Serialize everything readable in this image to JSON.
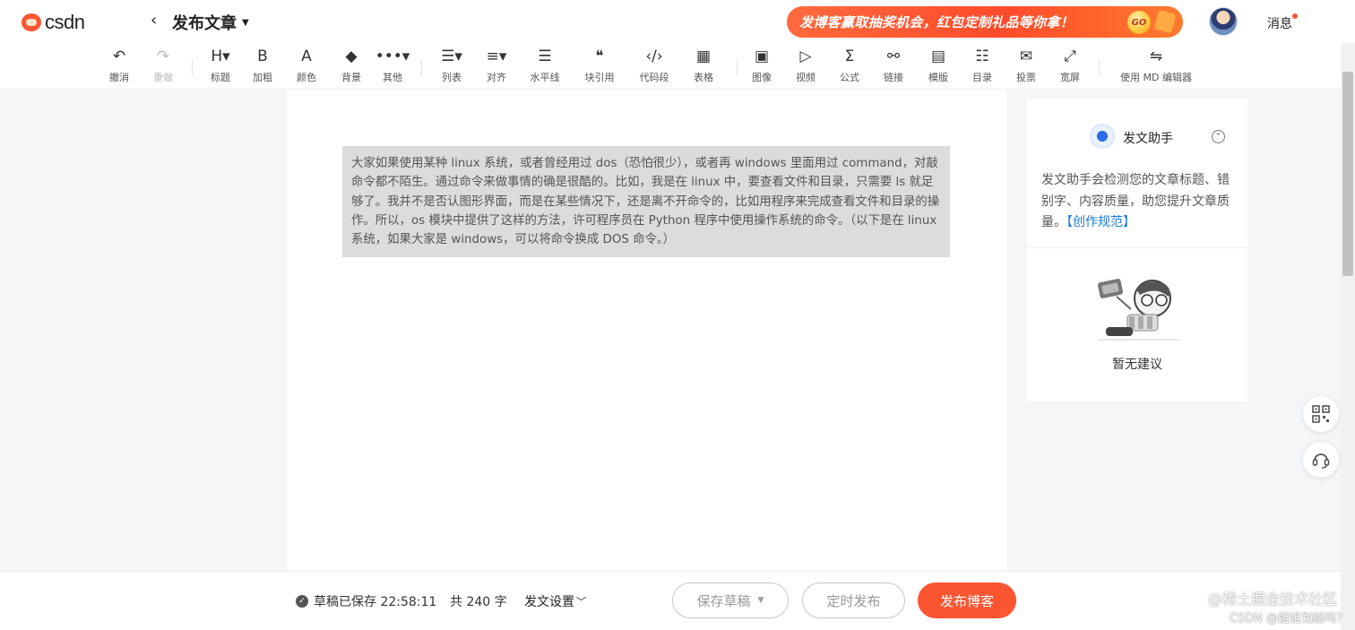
{
  "header": {
    "logo_text": "CSDN",
    "page_title": "发布文章",
    "banner_text": "发博客赢取抽奖机会，红包定制礼品等你拿！",
    "banner_go": "GO",
    "messages_label": "消息"
  },
  "toolbar": {
    "items": [
      {
        "icon": "↶",
        "label": "撤消",
        "disabled": false
      },
      {
        "icon": "↷",
        "label": "重做",
        "disabled": true
      },
      {
        "icon": "H▾",
        "label": "标题",
        "disabled": false
      },
      {
        "icon": "B",
        "label": "加粗",
        "disabled": false
      },
      {
        "icon": "A",
        "label": "颜色",
        "disabled": false
      },
      {
        "icon": "◆",
        "label": "背景",
        "disabled": false
      },
      {
        "icon": "•••▾",
        "label": "其他",
        "disabled": false
      },
      {
        "icon": "☰▾",
        "label": "列表",
        "disabled": false
      },
      {
        "icon": "≡▾",
        "label": "对齐",
        "disabled": false
      },
      {
        "icon": "☰",
        "label": "水平线",
        "disabled": false
      },
      {
        "icon": "❝",
        "label": "块引用",
        "disabled": false
      },
      {
        "icon": "‹/›",
        "label": "代码段",
        "disabled": false
      },
      {
        "icon": "▦",
        "label": "表格",
        "disabled": false
      },
      {
        "icon": "▣",
        "label": "图像",
        "disabled": false
      },
      {
        "icon": "▷",
        "label": "视频",
        "disabled": false
      },
      {
        "icon": "Σ",
        "label": "公式",
        "disabled": false
      },
      {
        "icon": "⚯",
        "label": "链接",
        "disabled": false
      },
      {
        "icon": "▤",
        "label": "模版",
        "disabled": false
      },
      {
        "icon": "☷",
        "label": "目录",
        "disabled": false
      },
      {
        "icon": "✉",
        "label": "投票",
        "disabled": false
      },
      {
        "icon": "⤢",
        "label": "宽屏",
        "disabled": false
      },
      {
        "icon": "⇋",
        "label": "使用 MD 编辑器",
        "disabled": false
      }
    ]
  },
  "editor": {
    "quote_text": "大家如果使用某种 linux 系统，或者曾经用过 dos（恐怕很少），或者再 windows 里面用过 command，对敲命令都不陌生。通过命令来做事情的确是很酷的。比如，我是在 linux 中，要查看文件和目录，只需要 ls 就足够了。我并不是否认图形界面，而是在某些情况下，还是离不开命令的，比如用程序来完成查看文件和目录的操作。所以，os 模块中提供了这样的方法，许可程序员在 Python 程序中使用操作系统的命令。（以下是在 linux 系统，如果大家是 windows，可以将命令换成 DOS 命令。）"
  },
  "assistant": {
    "title": "发文助手",
    "description": "发文助手会检测您的文章标题、错别字、内容质量，助您提升文章质量。",
    "link": "【创作规范】",
    "empty_text": "暂无建议"
  },
  "bottom": {
    "saved_status": "草稿已保存 22:58:11",
    "word_count": "共 240 字",
    "settings_label": "发文设置",
    "save_draft": "保存草稿",
    "schedule": "定时发布",
    "publish": "发布博客"
  },
  "watermark": {
    "line1": "@稀土掘金技术社区",
    "line2": "CSDN @姐姐划船吗？"
  },
  "colors": {
    "brand": "#fc5531",
    "link": "#1e7bd8",
    "quote_bg": "#dcdcdc"
  }
}
